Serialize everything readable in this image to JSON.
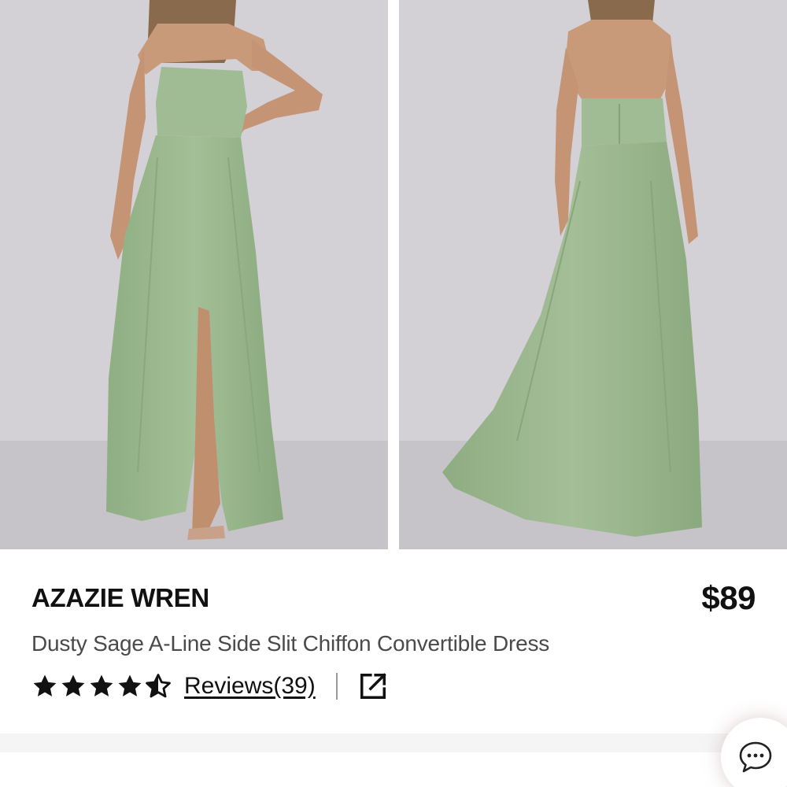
{
  "product": {
    "brand": "AZAZIE WREN",
    "price": "$89",
    "name": "Dusty Sage A-Line Side Slit Chiffon Convertible Dress",
    "rating": 4.5,
    "rating_max": 5,
    "reviews_label": "Reviews(39)"
  },
  "gallery": {
    "images": [
      {
        "view": "front"
      },
      {
        "view": "back"
      }
    ]
  },
  "icons": {
    "star": "star-icon",
    "share": "external-link-icon",
    "chat": "chat-icon"
  },
  "colors": {
    "dress": "#9cb88f",
    "text_primary": "#111111",
    "text_secondary": "#4a4a4a"
  }
}
